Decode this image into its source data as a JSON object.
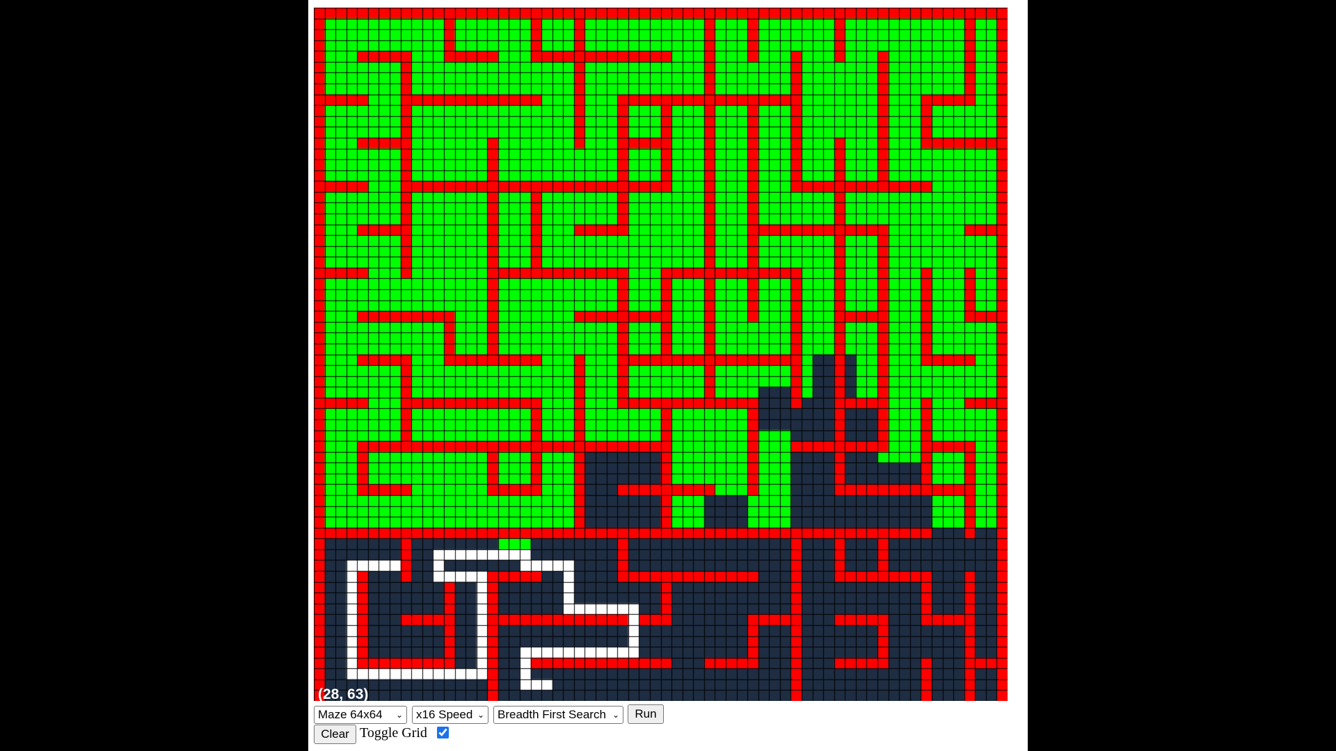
{
  "maze": {
    "rows": 64,
    "cols": 64,
    "coordinate_label": "(28, 63)",
    "colors": {
      "wall": "#ff0000",
      "visited": "#00ff00",
      "unvisited": "#1e2d42",
      "path": "#ffffff",
      "grid_line": "#000000"
    }
  },
  "controls": {
    "maze_select": {
      "selected": "Maze 64x64"
    },
    "speed_select": {
      "selected": "x16 Speed"
    },
    "algorithm_select": {
      "selected": "Breadth First Search"
    },
    "run_label": "Run",
    "clear_label": "Clear",
    "toggle_grid_label": "Toggle Grid",
    "toggle_grid_checked": true
  }
}
